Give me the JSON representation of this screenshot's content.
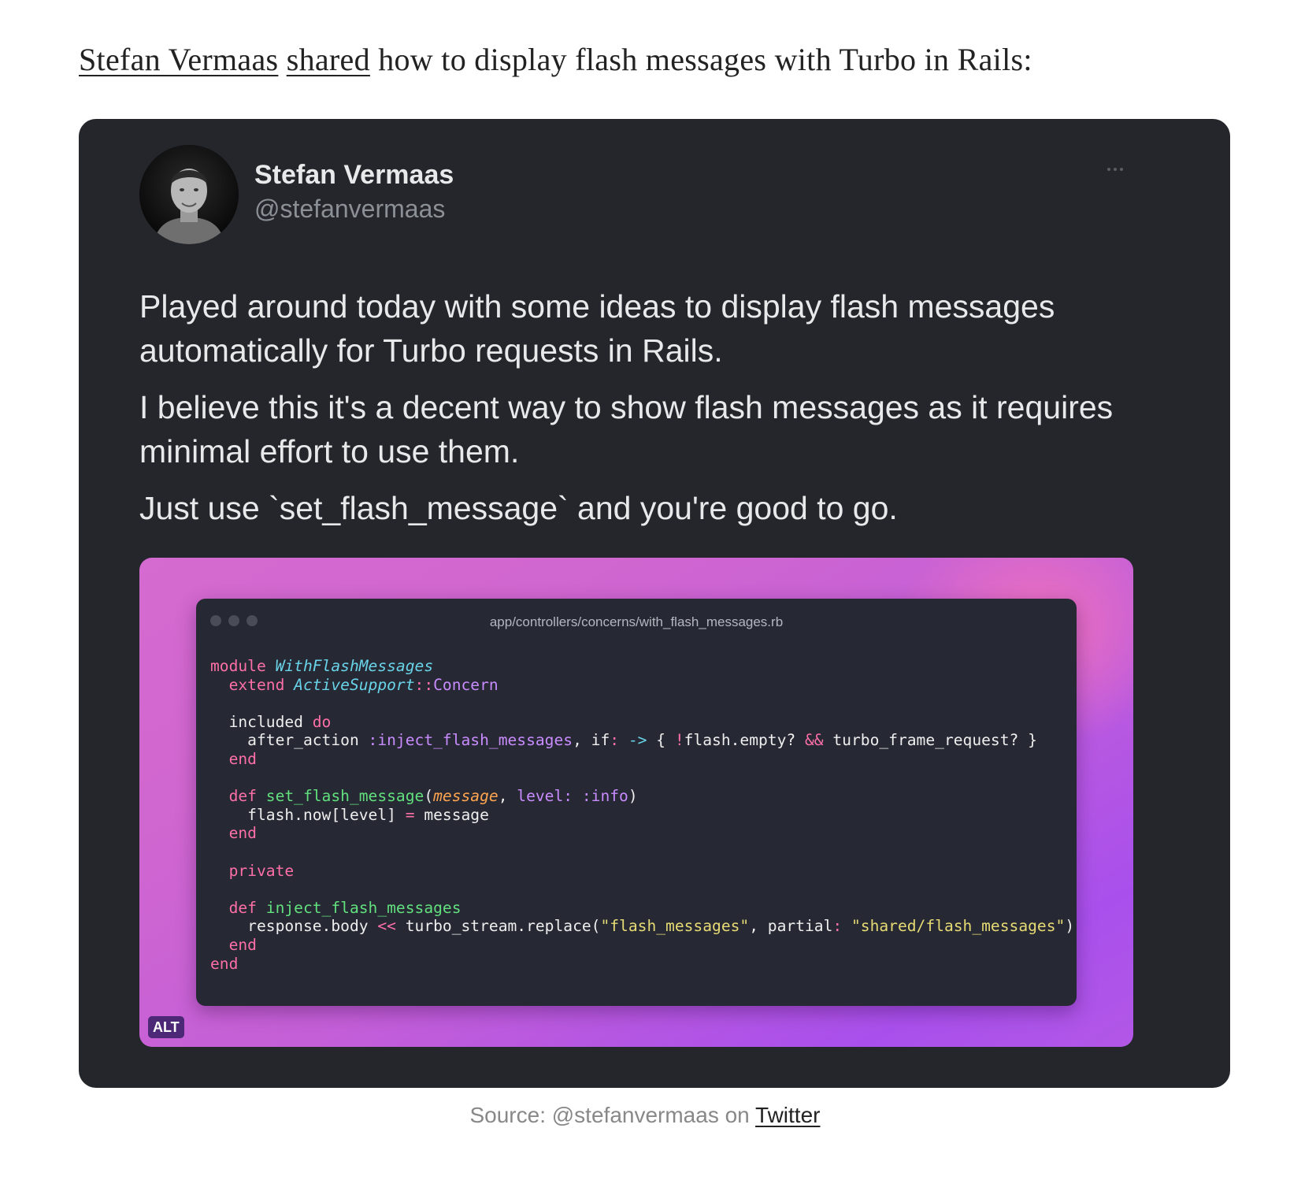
{
  "intro": {
    "author_link": "Stefan Vermaas",
    "shared_link": "shared",
    "rest": " how to display flash messages with Turbo in Rails:"
  },
  "tweet": {
    "author_name": "Stefan Vermaas",
    "author_handle": "@stefanvermaas",
    "more_icon": "more-horizontal-icon",
    "paragraphs": [
      "Played around today with some ideas to display flash messages automatically for Turbo requests in Rails.",
      "I believe this it's a decent way to show flash messages as it requires minimal effort to use them.",
      "Just use `set_flash_message` and you're good to go."
    ],
    "media": {
      "filename": "app/controllers/concerns/with_flash_messages.rb",
      "alt_badge": "ALT",
      "code_lines": [
        [
          [
            "kw",
            "module"
          ],
          [
            "plain",
            " "
          ],
          [
            "cls",
            "WithFlashMessages"
          ]
        ],
        [
          [
            "plain",
            "  "
          ],
          [
            "kw",
            "extend"
          ],
          [
            "plain",
            " "
          ],
          [
            "cls",
            "ActiveSupport"
          ],
          [
            "op",
            "::"
          ],
          [
            "con",
            "Concern"
          ]
        ],
        [],
        [
          [
            "plain",
            "  included "
          ],
          [
            "kw",
            "do"
          ]
        ],
        [
          [
            "plain",
            "    after_action "
          ],
          [
            "con",
            ":inject_flash_messages"
          ],
          [
            "plain",
            ", if"
          ],
          [
            "op",
            ":"
          ],
          [
            "plain",
            " "
          ],
          [
            "arrow",
            "->"
          ],
          [
            "plain",
            " { "
          ],
          [
            "op",
            "!"
          ],
          [
            "plain",
            "flash.empty? "
          ],
          [
            "op",
            "&&"
          ],
          [
            "plain",
            " turbo_frame_request? }"
          ]
        ],
        [
          [
            "plain",
            "  "
          ],
          [
            "kw",
            "end"
          ]
        ],
        [],
        [
          [
            "plain",
            "  "
          ],
          [
            "kw",
            "def"
          ],
          [
            "plain",
            " "
          ],
          [
            "fn",
            "set_flash_message"
          ],
          [
            "plain",
            "("
          ],
          [
            "param",
            "message"
          ],
          [
            "plain",
            ", "
          ],
          [
            "con",
            "level:"
          ],
          [
            "plain",
            " "
          ],
          [
            "con",
            ":info"
          ],
          [
            "plain",
            ")"
          ]
        ],
        [
          [
            "plain",
            "    flash.now[level] "
          ],
          [
            "op",
            "="
          ],
          [
            "plain",
            " message"
          ]
        ],
        [
          [
            "plain",
            "  "
          ],
          [
            "kw",
            "end"
          ]
        ],
        [],
        [
          [
            "plain",
            "  "
          ],
          [
            "kw",
            "private"
          ]
        ],
        [],
        [
          [
            "plain",
            "  "
          ],
          [
            "kw",
            "def"
          ],
          [
            "plain",
            " "
          ],
          [
            "fn",
            "inject_flash_messages"
          ]
        ],
        [
          [
            "plain",
            "    response.body "
          ],
          [
            "op",
            "<<"
          ],
          [
            "plain",
            " turbo_stream.replace("
          ],
          [
            "str",
            "\"flash_messages\""
          ],
          [
            "plain",
            ", partial"
          ],
          [
            "op",
            ":"
          ],
          [
            "plain",
            " "
          ],
          [
            "str",
            "\"shared/flash_messages\""
          ],
          [
            "plain",
            ")"
          ]
        ],
        [
          [
            "plain",
            "  "
          ],
          [
            "kw",
            "end"
          ]
        ],
        [
          [
            "kw",
            "end"
          ]
        ]
      ]
    }
  },
  "caption": {
    "prefix": "Source: @stefanvermaas on ",
    "link": "Twitter"
  }
}
